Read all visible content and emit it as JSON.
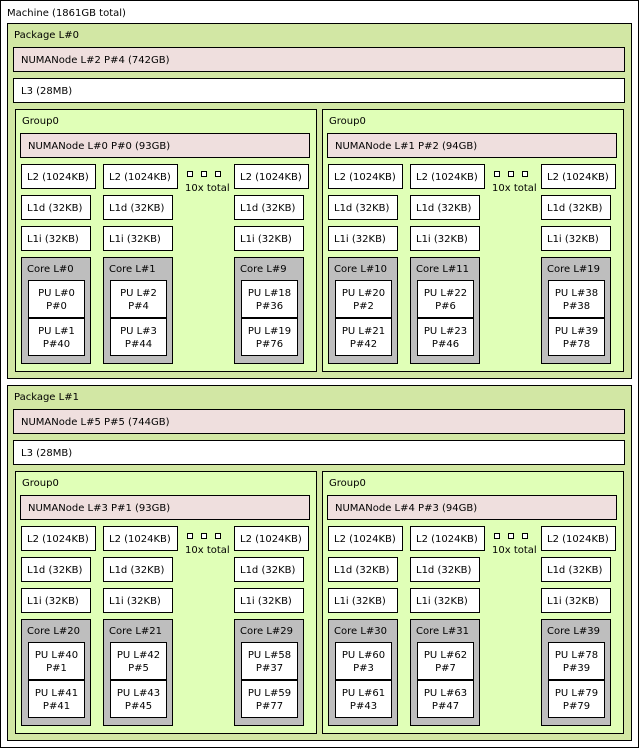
{
  "machine": {
    "label": "Machine (1861GB total)"
  },
  "packages": [
    {
      "label": "Package L#0",
      "numa": "NUMANode L#2 P#4 (742GB)",
      "l3": "L3 (28MB)",
      "groups": [
        {
          "label": "Group0",
          "numa": "NUMANode L#0 P#0 (93GB)",
          "l2": "L2 (1024KB)",
          "l1d": "L1d (32KB)",
          "l1i": "L1i (32KB)",
          "total": "10x total",
          "cores": [
            {
              "label": "Core L#0",
              "pus": [
                [
                  "PU L#0",
                  "P#0"
                ],
                [
                  "PU L#1",
                  "P#40"
                ]
              ]
            },
            {
              "label": "Core L#1",
              "pus": [
                [
                  "PU L#2",
                  "P#4"
                ],
                [
                  "PU L#3",
                  "P#44"
                ]
              ]
            },
            {
              "label": "Core L#9",
              "pus": [
                [
                  "PU L#18",
                  "P#36"
                ],
                [
                  "PU L#19",
                  "P#76"
                ]
              ]
            }
          ]
        },
        {
          "label": "Group0",
          "numa": "NUMANode L#1 P#2 (94GB)",
          "l2": "L2 (1024KB)",
          "l1d": "L1d (32KB)",
          "l1i": "L1i (32KB)",
          "total": "10x total",
          "cores": [
            {
              "label": "Core L#10",
              "pus": [
                [
                  "PU L#20",
                  "P#2"
                ],
                [
                  "PU L#21",
                  "P#42"
                ]
              ]
            },
            {
              "label": "Core L#11",
              "pus": [
                [
                  "PU L#22",
                  "P#6"
                ],
                [
                  "PU L#23",
                  "P#46"
                ]
              ]
            },
            {
              "label": "Core L#19",
              "pus": [
                [
                  "PU L#38",
                  "P#38"
                ],
                [
                  "PU L#39",
                  "P#78"
                ]
              ]
            }
          ]
        }
      ]
    },
    {
      "label": "Package L#1",
      "numa": "NUMANode L#5 P#5 (744GB)",
      "l3": "L3 (28MB)",
      "groups": [
        {
          "label": "Group0",
          "numa": "NUMANode L#3 P#1 (93GB)",
          "l2": "L2 (1024KB)",
          "l1d": "L1d (32KB)",
          "l1i": "L1i (32KB)",
          "total": "10x total",
          "cores": [
            {
              "label": "Core L#20",
              "pus": [
                [
                  "PU L#40",
                  "P#1"
                ],
                [
                  "PU L#41",
                  "P#41"
                ]
              ]
            },
            {
              "label": "Core L#21",
              "pus": [
                [
                  "PU L#42",
                  "P#5"
                ],
                [
                  "PU L#43",
                  "P#45"
                ]
              ]
            },
            {
              "label": "Core L#29",
              "pus": [
                [
                  "PU L#58",
                  "P#37"
                ],
                [
                  "PU L#59",
                  "P#77"
                ]
              ]
            }
          ]
        },
        {
          "label": "Group0",
          "numa": "NUMANode L#4 P#3 (94GB)",
          "l2": "L2 (1024KB)",
          "l1d": "L1d (32KB)",
          "l1i": "L1i (32KB)",
          "total": "10x total",
          "cores": [
            {
              "label": "Core L#30",
              "pus": [
                [
                  "PU L#60",
                  "P#3"
                ],
                [
                  "PU L#61",
                  "P#43"
                ]
              ]
            },
            {
              "label": "Core L#31",
              "pus": [
                [
                  "PU L#62",
                  "P#7"
                ],
                [
                  "PU L#63",
                  "P#47"
                ]
              ]
            },
            {
              "label": "Core L#39",
              "pus": [
                [
                  "PU L#78",
                  "P#39"
                ],
                [
                  "PU L#79",
                  "P#79"
                ]
              ]
            }
          ]
        }
      ]
    }
  ]
}
